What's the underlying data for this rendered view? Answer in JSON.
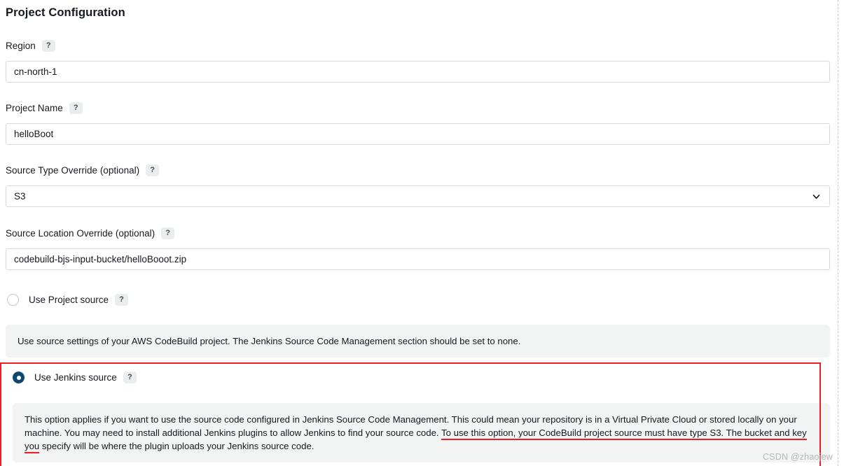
{
  "page": {
    "title": "Project Configuration",
    "help_icon_glyph": "?",
    "accent_red": "#e81f27",
    "radio_selected_color": "#0f4a6e",
    "panel_bg": "#f2f3f3"
  },
  "fields": [
    {
      "label": "Region",
      "help": "?",
      "value": "cn-north-1",
      "type": "text"
    },
    {
      "label": "Project Name",
      "help": "?",
      "value": "helloBoot",
      "type": "text"
    },
    {
      "label": "Source Type Override (optional)",
      "help": "?",
      "value": "S3",
      "type": "select",
      "chevron_icon": "chevron-down-icon"
    },
    {
      "label": "Source Location Override (optional)",
      "help": "?",
      "value": "codebuild-bjs-input-bucket/helloBooot.zip",
      "type": "text"
    }
  ],
  "source_options": {
    "project_source": {
      "label": "Use Project source",
      "help": "?",
      "selected": false,
      "description": "Use source settings of your AWS CodeBuild project. The Jenkins Source Code Management section should be set to none."
    },
    "jenkins_source": {
      "label": "Use Jenkins source",
      "help": "?",
      "selected": true,
      "description_part1": "This option applies if you want to use the source code configured in Jenkins Source Code Management. This could mean your repository is in a Virtual Private Cloud or stored locally on your machine. You may need to install additional Jenkins plugins to allow Jenkins to find your source code. ",
      "description_highlighted": "To use this option, your CodeBuild project source must have type S3. The bucket and key you",
      "description_part2": " specify will be where the plugin uploads your Jenkins source code."
    }
  },
  "watermark": "CSDN @zhaojew"
}
